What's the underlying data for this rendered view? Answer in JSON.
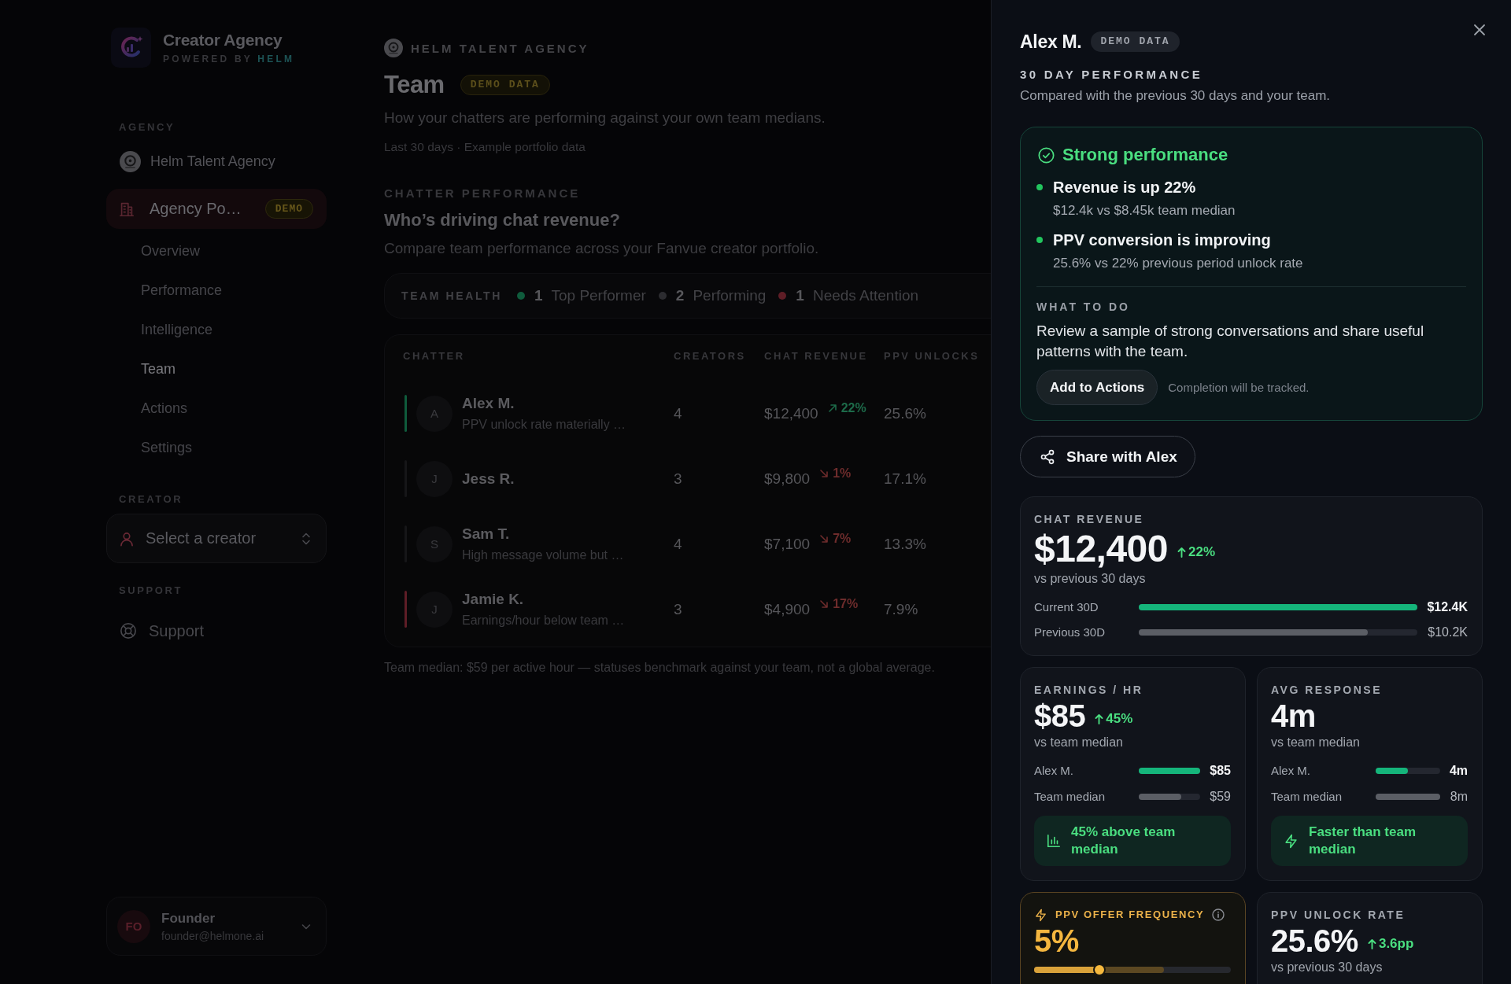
{
  "sidebar": {
    "brand": {
      "title": "Creator Agency",
      "powered_by": "POWERED BY",
      "brand": "HELM"
    },
    "agency_section": {
      "label": "AGENCY",
      "agency_name": "Helm Talent Agency",
      "workspace": {
        "label": "Agency Po…",
        "badge": "DEMO",
        "selected": true
      },
      "items": [
        {
          "label": "Overview",
          "selected": false
        },
        {
          "label": "Performance",
          "selected": false
        },
        {
          "label": "Intelligence",
          "selected": false
        },
        {
          "label": "Team",
          "selected": true
        },
        {
          "label": "Actions",
          "selected": false
        },
        {
          "label": "Settings",
          "selected": false
        }
      ]
    },
    "creator_section": {
      "label": "CREATOR",
      "select": {
        "placeholder": "Select a creator"
      }
    },
    "support_section": {
      "label": "SUPPORT",
      "link": "Support"
    },
    "user": {
      "initials": "FO",
      "name": "Founder",
      "email": "founder@helmone.ai"
    }
  },
  "page": {
    "agency": "HELM TALENT AGENCY",
    "title": "Team",
    "badge": "DEMO DATA",
    "subtitle": "How your chatters are performing against your own team medians.",
    "meta": "Last 30 days · Example portfolio data"
  },
  "chatter_performance": {
    "eyebrow": "CHATTER PERFORMANCE",
    "title": "Who’s driving chat revenue?",
    "description": "Compare team performance across your Fanvue creator portfolio.",
    "team_health": {
      "label": "TEAM HEALTH",
      "groups": [
        {
          "count": "1",
          "label": "Top Performer",
          "color": "#0f5b3c"
        },
        {
          "count": "2",
          "label": "Performing",
          "color": "#2c2c30"
        },
        {
          "count": "1",
          "label": "Needs Attention",
          "color": "#5e1d26"
        }
      ]
    },
    "table": {
      "columns": [
        "CHATTER",
        "CREATORS",
        "CHAT REVENUE",
        "PPV UNLOCKS"
      ],
      "rows": [
        {
          "initial": "A",
          "name": "Alex M.",
          "note": "PPV unlock rate materially …",
          "color": "#0f5b3c",
          "creators": "4",
          "revenue": "$12,400",
          "trend": {
            "kind": "up",
            "value": "22%"
          },
          "ppv_unlocks": "25.6%"
        },
        {
          "initial": "J",
          "name": "Jess R.",
          "color": "#161618",
          "creators": "3",
          "revenue": "$9,800",
          "trend": {
            "kind": "down",
            "value": "1%"
          },
          "ppv_unlocks": "17.1%"
        },
        {
          "initial": "S",
          "name": "Sam T.",
          "note": "High message volume but …",
          "color": "#161618",
          "creators": "4",
          "revenue": "$7,100",
          "trend": {
            "kind": "down",
            "value": "7%"
          },
          "ppv_unlocks": "13.3%"
        },
        {
          "initial": "J",
          "name": "Jamie K.",
          "note": "Earnings/hour below team …",
          "color": "#5e1d26",
          "creators": "3",
          "revenue": "$4,900",
          "trend": {
            "kind": "down",
            "value": "17%"
          },
          "ppv_unlocks": "7.9%"
        }
      ]
    },
    "footnote": "Team median: $59 per active hour — statuses benchmark against your team, not a global average."
  },
  "detail_panel": {
    "name": "Alex M.",
    "badge": "DEMO DATA",
    "eyebrow": "30 DAY PERFORMANCE",
    "subtitle": "Compared with the previous 30 days and your team.",
    "insight": {
      "title": "Strong performance",
      "points": [
        {
          "title": "Revenue is up 22%",
          "detail": "$12.4k vs $8.45k team median"
        },
        {
          "title": "PPV conversion is improving",
          "detail": "25.6% vs 22% previous period unlock rate"
        }
      ],
      "action_label": "WHAT TO DO",
      "action_text": "Review a sample of strong conversations and share useful patterns with the team.",
      "button": "Add to Actions",
      "note": "Completion will be tracked."
    },
    "share_button": "Share with Alex",
    "metrics": [
      {
        "kind": "headline",
        "label": "CHAT REVENUE",
        "value": "$12,400",
        "change": {
          "kind": "up",
          "value": "22%"
        },
        "caption": "vs previous 30 days",
        "bars": [
          {
            "kind": "subject",
            "label": "Current 30D",
            "level": 1,
            "reading": "$12.4K"
          },
          {
            "kind": "benchmark",
            "label": "Previous 30D",
            "level": 0.82,
            "reading": "$10.2K"
          }
        ]
      },
      {
        "kind": "standard",
        "label": "EARNINGS / HR",
        "value": "$85",
        "change": {
          "kind": "up",
          "value": "45%"
        },
        "caption": "vs team median",
        "bars": [
          {
            "kind": "subject",
            "label": "Alex M.",
            "level": 1,
            "reading": "$85"
          },
          {
            "kind": "benchmark",
            "label": "Team median",
            "level": 0.69,
            "reading": "$59"
          }
        ],
        "callout": {
          "kind": "earnings",
          "text": "45% above team median"
        }
      },
      {
        "kind": "standard",
        "label": "AVG RESPONSE",
        "value": "4m",
        "caption": "vs team median",
        "bars": [
          {
            "kind": "subject",
            "label": "Alex M.",
            "level": 0.5,
            "reading": "4m"
          },
          {
            "kind": "benchmark",
            "label": "Team median",
            "level": 1,
            "reading": "8m"
          }
        ],
        "callout": {
          "kind": "speed",
          "text": "Faster than team median"
        }
      },
      {
        "kind": "warning",
        "label": "PPV OFFER FREQUENCY",
        "value": "5%",
        "slider": {
          "level": 0.33,
          "band": {
            "level": 0.66
          }
        }
      },
      {
        "kind": "standard",
        "label": "PPV UNLOCK RATE",
        "value": "25.6%",
        "change": {
          "kind": "up",
          "value": "3.6pp"
        },
        "caption": "vs previous 30 days"
      }
    ]
  }
}
